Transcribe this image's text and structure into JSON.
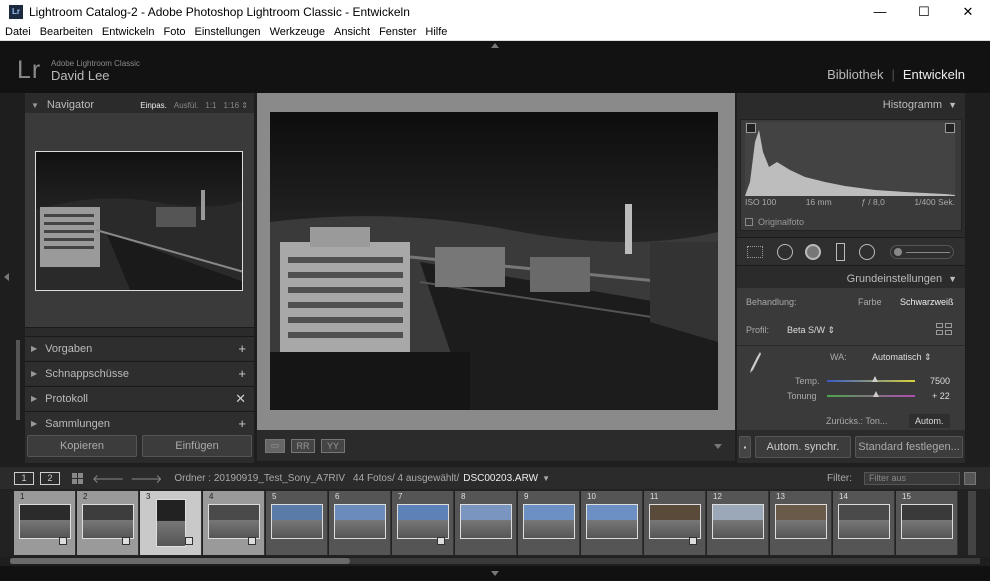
{
  "window": {
    "title": "Lightroom Catalog-2 - Adobe Photoshop Lightroom Classic - Entwickeln",
    "app_icon": "Lr",
    "controls": {
      "minimize": "—",
      "maximize": "☐",
      "close": "✕"
    }
  },
  "menu": [
    "Datei",
    "Bearbeiten",
    "Entwickeln",
    "Foto",
    "Einstellungen",
    "Werkzeuge",
    "Ansicht",
    "Fenster",
    "Hilfe"
  ],
  "identity": {
    "logo": "Lr",
    "app_name": "Adobe Lightroom Classic",
    "user": "David Lee"
  },
  "modules": {
    "library": "Bibliothek",
    "separator": "|",
    "develop": "Entwickeln",
    "active": "develop"
  },
  "left_panel": {
    "navigator": {
      "title": "Navigator",
      "zoom": [
        "Einpas.",
        "Ausfül.",
        "1:1",
        "1:16 ⇕"
      ],
      "active_zoom": 0
    },
    "sections": [
      {
        "label": "Vorgaben",
        "action": "+"
      },
      {
        "label": "Schnappschüsse",
        "action": "+"
      },
      {
        "label": "Protokoll",
        "action": "✕"
      },
      {
        "label": "Sammlungen",
        "action": "+"
      }
    ],
    "buttons": {
      "copy": "Kopieren",
      "paste": "Einfügen"
    }
  },
  "right_panel": {
    "histogram": {
      "title": "Histogramm",
      "iso": "ISO 100",
      "focal": "16 mm",
      "aperture": "ƒ / 8,0",
      "shutter": "1/400 Sek.",
      "original_photo": "Originalfoto"
    },
    "basic": {
      "title": "Grundeinstellungen",
      "treatment_label": "Behandlung:",
      "treatment_color": "Farbe",
      "treatment_bw": "Schwarzweiß",
      "profile_label": "Profil:",
      "profile_value": "Beta S/W ⇕",
      "wb_label": "WA:",
      "wb_value": "Automatisch ⇕",
      "temp_label": "Temp.",
      "temp_value": "7500",
      "temp_level": 0.55,
      "tint_label": "Tonung",
      "tint_value": "+ 22",
      "tint_level": 0.56,
      "reset_label": "Zurücks.: Ton...",
      "auto_label": "Autom."
    },
    "buttons": {
      "sync": "Autom. synchr.",
      "defaults": "Standard festlegen..."
    }
  },
  "filmbar": {
    "pages": [
      "1",
      "2"
    ],
    "folder_label": "Ordner : 20190919_Test_Sony_A7RIV",
    "count": "44 Fotos/ 4 ausgewählt/",
    "current_file": "DSC00203.ARW",
    "filter_label": "Filter:",
    "filter_value": "Filter aus"
  },
  "filmstrip": [
    {
      "n": "1",
      "state": "sel",
      "badge": true
    },
    {
      "n": "2",
      "state": "sel",
      "badge": true
    },
    {
      "n": "3",
      "state": "cur",
      "badge": true,
      "portrait": true
    },
    {
      "n": "4",
      "state": "sel",
      "badge": true
    },
    {
      "n": "5",
      "state": "",
      "badge": false
    },
    {
      "n": "6",
      "state": "",
      "badge": false
    },
    {
      "n": "7",
      "state": "",
      "badge": true
    },
    {
      "n": "8",
      "state": "",
      "badge": false
    },
    {
      "n": "9",
      "state": "",
      "badge": false
    },
    {
      "n": "10",
      "state": "",
      "badge": false
    },
    {
      "n": "11",
      "state": "",
      "badge": true
    },
    {
      "n": "12",
      "state": "",
      "badge": false
    },
    {
      "n": "13",
      "state": "",
      "badge": false
    },
    {
      "n": "14",
      "state": "",
      "badge": false
    },
    {
      "n": "15",
      "state": "",
      "badge": false
    }
  ],
  "colors": {
    "bg": "#1e1e1e",
    "panel": "#2b2b2b",
    "canvas": "#8a8a8a",
    "accent_text": "#eeeeee"
  }
}
